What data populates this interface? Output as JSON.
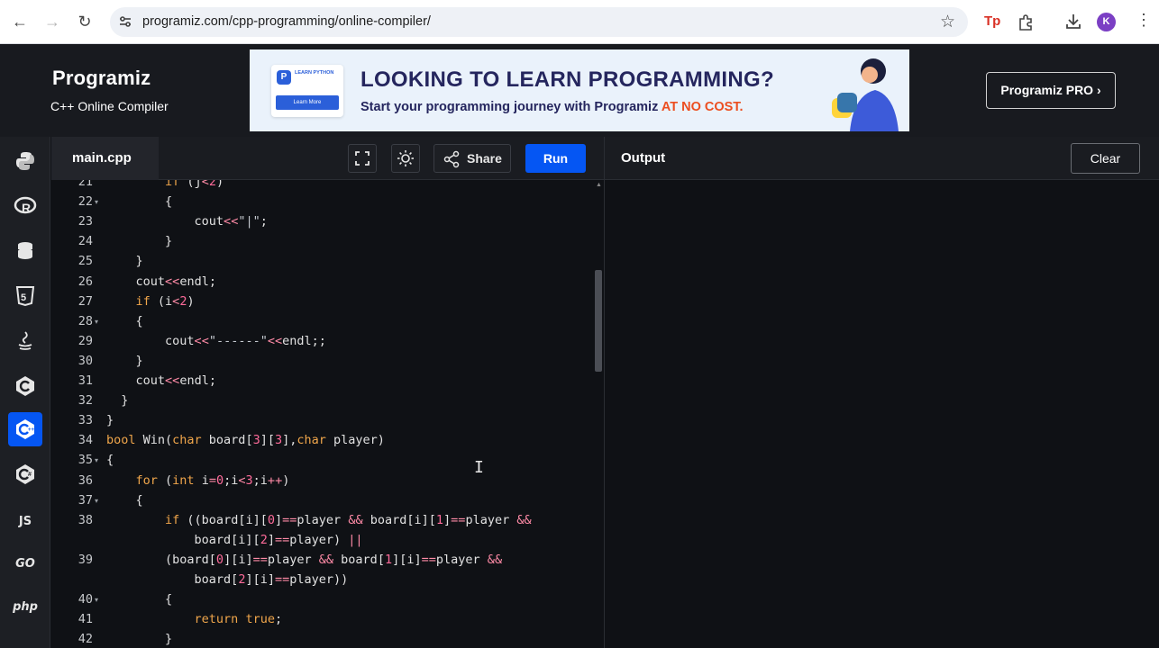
{
  "browser": {
    "url": "programiz.com/cpp-programming/online-compiler/",
    "avatar_letter": "K",
    "tp_label": "Tp"
  },
  "header": {
    "logo_text": "Programiz",
    "subtitle": "C++ Online Compiler",
    "pro_button": "Programiz PRO ›"
  },
  "banner": {
    "book_label": "LEARN PYTHON",
    "book_button": "Learn More",
    "headline": "LOOKING TO LEARN PROGRAMMING?",
    "tagline": "Start your programming journey with Programiz ",
    "tagline_accent": "AT NO COST."
  },
  "rail": {
    "items": [
      "python-icon",
      "r-icon",
      "sql-icon",
      "html-icon",
      "java-icon",
      "c-icon",
      "cpp-icon",
      "csharp-icon",
      "js-icon",
      "go-icon",
      "php-icon"
    ],
    "js_label": "JS",
    "go_label": "GO",
    "php_label": "php",
    "active_index": 6
  },
  "editor": {
    "file_tab": "main.cpp",
    "share_label": "Share",
    "run_label": "Run",
    "lines": [
      {
        "n": "21",
        "fold": false,
        "code": "        if (j<2)"
      },
      {
        "n": "22",
        "fold": true,
        "code": "        {"
      },
      {
        "n": "23",
        "fold": false,
        "code": "            cout<<\"|\";"
      },
      {
        "n": "24",
        "fold": false,
        "code": "        }"
      },
      {
        "n": "25",
        "fold": false,
        "code": "    }"
      },
      {
        "n": "26",
        "fold": false,
        "code": "    cout<<endl;"
      },
      {
        "n": "27",
        "fold": false,
        "code": "    if (i<2)"
      },
      {
        "n": "28",
        "fold": true,
        "code": "    {"
      },
      {
        "n": "29",
        "fold": false,
        "code": "        cout<<\"------\"<<endl;;"
      },
      {
        "n": "30",
        "fold": false,
        "code": "    }"
      },
      {
        "n": "31",
        "fold": false,
        "code": "    cout<<endl;"
      },
      {
        "n": "32",
        "fold": false,
        "code": "  }"
      },
      {
        "n": "33",
        "fold": false,
        "code": "}"
      },
      {
        "n": "34",
        "fold": false,
        "code": "bool Win(char board[3][3],char player)"
      },
      {
        "n": "35",
        "fold": true,
        "code": "{"
      },
      {
        "n": "36",
        "fold": false,
        "code": "    for (int i=0;i<3;i++)"
      },
      {
        "n": "37",
        "fold": true,
        "code": "    {"
      },
      {
        "n": "38",
        "fold": false,
        "code": "        if ((board[i][0]==player && board[i][1]==player &&"
      },
      {
        "n": "",
        "fold": false,
        "code": "            board[i][2]==player) ||"
      },
      {
        "n": "39",
        "fold": false,
        "code": "        (board[0][i]==player && board[1][i]==player &&"
      },
      {
        "n": "",
        "fold": false,
        "code": "            board[2][i]==player))"
      },
      {
        "n": "40",
        "fold": true,
        "code": "        {"
      },
      {
        "n": "41",
        "fold": false,
        "code": "            return true;"
      },
      {
        "n": "42",
        "fold": false,
        "code": "        }"
      }
    ]
  },
  "output": {
    "title": "Output",
    "clear_label": "Clear"
  }
}
